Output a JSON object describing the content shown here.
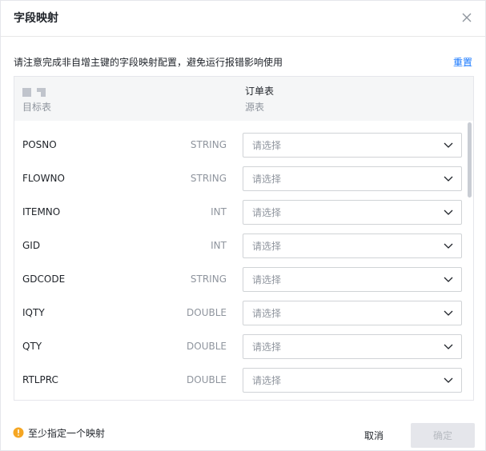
{
  "dialog": {
    "title": "字段映射",
    "close_icon": "close-icon"
  },
  "notice": {
    "text": "请注意完成非自增主键的字段映射配置，避免运行报错影响使用",
    "reset_label": "重置"
  },
  "table": {
    "target_icon": "table-grid-icon",
    "target_header": "目标表",
    "source_title": "订单表",
    "source_header": "源表",
    "select_placeholder": "请选择",
    "rows": [
      {
        "name": "POSNO",
        "type": "STRING"
      },
      {
        "name": "FLOWNO",
        "type": "STRING"
      },
      {
        "name": "ITEMNO",
        "type": "INT"
      },
      {
        "name": "GID",
        "type": "INT"
      },
      {
        "name": "GDCODE",
        "type": "STRING"
      },
      {
        "name": "IQTY",
        "type": "DOUBLE"
      },
      {
        "name": "QTY",
        "type": "DOUBLE"
      },
      {
        "name": "RTLPRC",
        "type": "DOUBLE"
      }
    ]
  },
  "footer": {
    "warning_icon": "warning-icon",
    "warning_text": "至少指定一个映射",
    "cancel_label": "取消",
    "confirm_label": "确定"
  },
  "colors": {
    "accent": "#1677ff",
    "warning": "#f5a623",
    "disabled_bg": "#e5e6eb"
  }
}
